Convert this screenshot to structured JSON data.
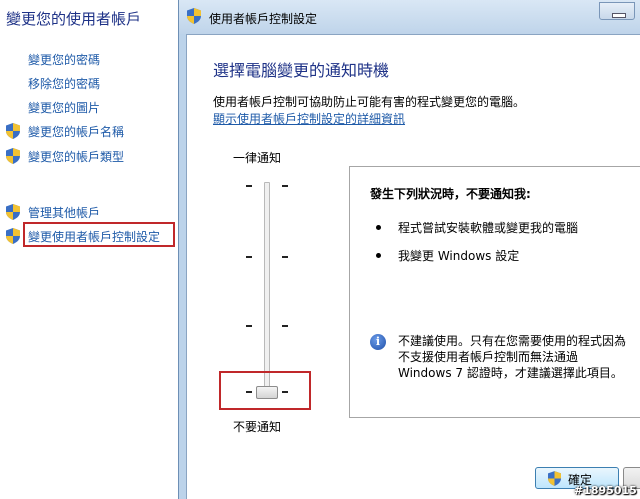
{
  "control_panel": {
    "title": "變更您的使用者帳戶",
    "links": [
      {
        "label": "變更您的密碼",
        "has_shield": false
      },
      {
        "label": "移除您的密碼",
        "has_shield": false
      },
      {
        "label": "變更您的圖片",
        "has_shield": false
      },
      {
        "label": "變更您的帳戶名稱",
        "has_shield": true
      },
      {
        "label": "變更您的帳戶類型",
        "has_shield": true
      },
      {
        "label": "管理其他帳戶",
        "has_shield": true
      },
      {
        "label": "變更使用者帳戶控制設定",
        "has_shield": true,
        "highlighted": true
      }
    ]
  },
  "dialog": {
    "title": "使用者帳戶控制設定",
    "heading": "選擇電腦變更的通知時機",
    "description": "使用者帳戶控制可協助防止可能有害的程式變更您的電腦。",
    "more_info_link": "顯示使用者帳戶控制設定的詳細資訊",
    "slider": {
      "top_label": "一律通知",
      "bottom_label": "不要通知",
      "levels": 4,
      "selected_level": 1
    },
    "info_box": {
      "heading": "發生下列狀況時，不要通知我:",
      "bullets": [
        "程式嘗試安裝軟體或變更我的電腦",
        "我變更 Windows 設定"
      ],
      "note": "不建議使用。只有在您需要使用的程式因為不支援使用者帳戶控制而無法通過 Windows 7 認證時，才建議選擇此項目。"
    },
    "ok_label": "確定"
  },
  "watermark": "#1895015",
  "colors": {
    "link": "#1e5aa8",
    "heading": "#1e3287",
    "highlight": "#c0282a",
    "window_frame": "#bcd3ea"
  },
  "icons": {
    "shield": "uac-shield-icon",
    "info": "info-icon"
  }
}
